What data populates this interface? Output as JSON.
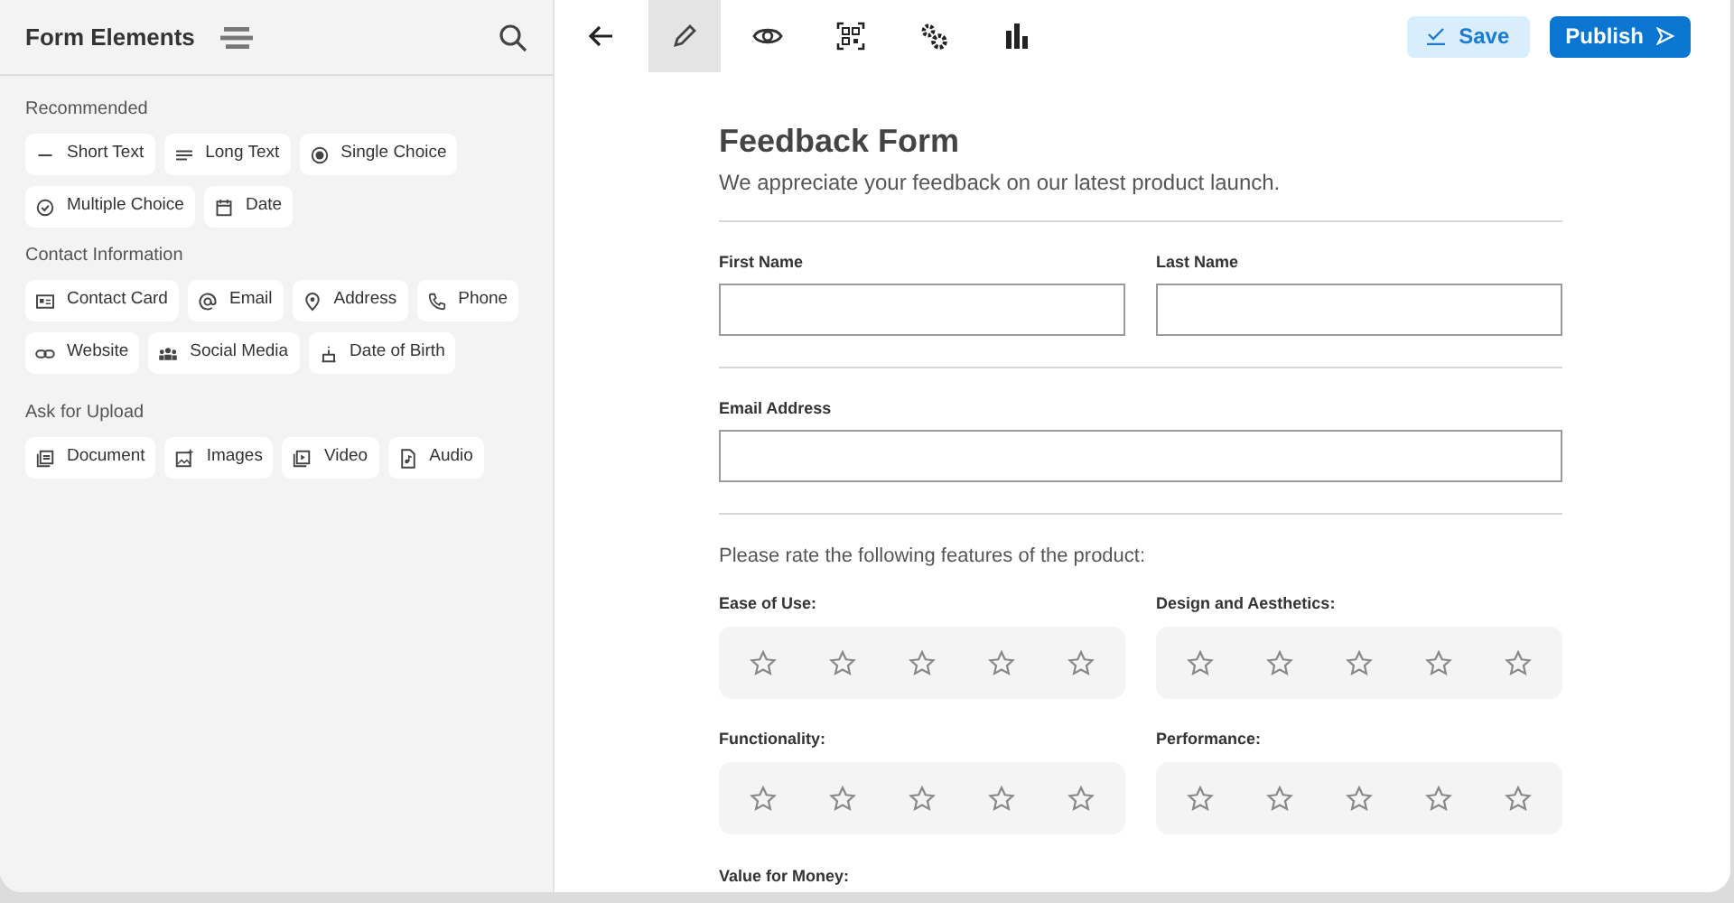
{
  "sidebar": {
    "title": "Form Elements",
    "sections": [
      {
        "heading": "Recommended",
        "items": [
          {
            "label": "Short Text",
            "kind": "short_text"
          },
          {
            "label": "Long Text",
            "kind": "long_text"
          },
          {
            "label": "Single Choice",
            "kind": "single_choice"
          },
          {
            "label": "Multiple Choice",
            "kind": "multiple_choice"
          },
          {
            "label": "Date",
            "kind": "date"
          }
        ]
      },
      {
        "heading": "Contact Information",
        "items": [
          {
            "label": "Contact Card",
            "kind": "contact_card"
          },
          {
            "label": "Email",
            "kind": "email"
          },
          {
            "label": "Address",
            "kind": "address"
          },
          {
            "label": "Phone",
            "kind": "phone"
          },
          {
            "label": "Website",
            "kind": "website"
          },
          {
            "label": "Social Media",
            "kind": "social_media"
          },
          {
            "label": "Date of Birth",
            "kind": "date_of_birth"
          }
        ]
      },
      {
        "heading": "Ask for Upload",
        "items": [
          {
            "label": "Document",
            "kind": "document"
          },
          {
            "label": "Images",
            "kind": "images"
          },
          {
            "label": "Video",
            "kind": "video"
          },
          {
            "label": "Audio",
            "kind": "audio"
          }
        ]
      }
    ]
  },
  "toolbar": {
    "tools": [
      {
        "kind": "back",
        "selected": false
      },
      {
        "kind": "edit",
        "selected": true
      },
      {
        "kind": "preview",
        "selected": false
      },
      {
        "kind": "qr",
        "selected": false
      },
      {
        "kind": "settings",
        "selected": false
      },
      {
        "kind": "stats",
        "selected": false
      }
    ],
    "save": "Save",
    "publish": "Publish"
  },
  "form": {
    "title": "Feedback Form",
    "description": "We appreciate your feedback on our latest product launch.",
    "name_fields": [
      {
        "label": "First Name"
      },
      {
        "label": "Last Name"
      }
    ],
    "email_field": {
      "label": "Email Address"
    },
    "rating_prompt": "Please rate the following features of the product:",
    "ratings": [
      {
        "label": "Ease of Use:",
        "stars": 0
      },
      {
        "label": "Design and Aesthetics:",
        "stars": 0
      },
      {
        "label": "Functionality:",
        "stars": 0
      },
      {
        "label": "Performance:",
        "stars": 0
      }
    ],
    "cut_label": "Value for Money:"
  }
}
